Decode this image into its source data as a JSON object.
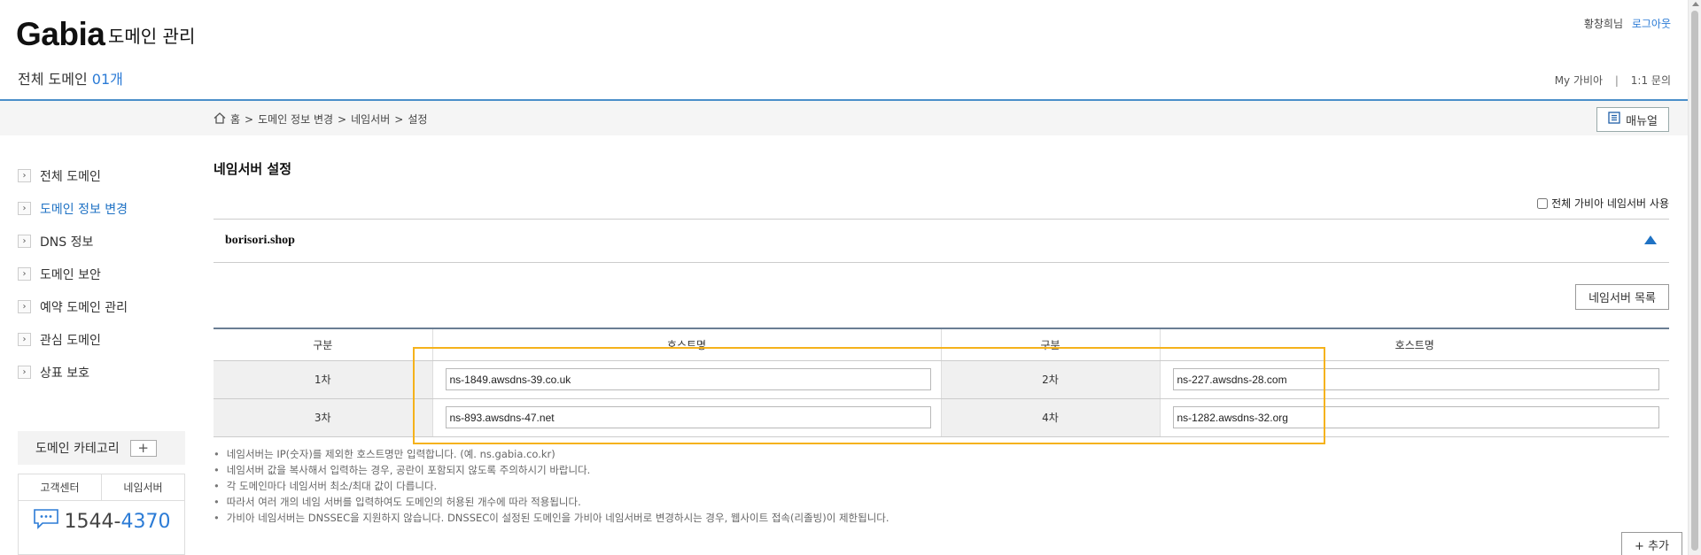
{
  "header": {
    "logo": "Gabia",
    "subtitle": "도메인 관리",
    "total_label": "전체 도메인",
    "total_count": "01개",
    "user_name": "황창희님",
    "logout": "로그아웃",
    "util_links": [
      "My 가비아",
      "1:1 문의"
    ]
  },
  "breadcrumb": {
    "home": "홈",
    "items": [
      "도메인 정보 변경",
      "네임서버",
      "설정"
    ],
    "separator": ">"
  },
  "manual_button": "매뉴얼",
  "sidebar": {
    "items": [
      {
        "label": "전체 도메인",
        "active": false
      },
      {
        "label": "도메인 정보 변경",
        "active": true
      },
      {
        "label": "DNS 정보",
        "active": false
      },
      {
        "label": "도메인 보안",
        "active": false
      },
      {
        "label": "예약 도메인 관리",
        "active": false
      },
      {
        "label": "관심 도메인",
        "active": false
      },
      {
        "label": "상표 보호",
        "active": false
      }
    ],
    "category_label": "도메인 카테고리",
    "category_add": "+",
    "support_tabs": [
      "고객센터",
      "네임서버"
    ],
    "phone_prefix": "1544-",
    "phone_suffix": "4370"
  },
  "main": {
    "title": "네임서버 설정",
    "all_gabia_ns_label": "전체 가비아 네임서버 사용",
    "domain": "borisori.shop",
    "ns_list_button": "네임서버 목록",
    "table_headers": [
      "구분",
      "호스트명",
      "구분",
      "호스트명"
    ],
    "rows": [
      {
        "label_a": "1차",
        "host_a": "ns-1849.awsdns-39.co.uk",
        "label_b": "2차",
        "host_b": "ns-227.awsdns-28.com"
      },
      {
        "label_a": "3차",
        "host_a": "ns-893.awsdns-47.net",
        "label_b": "4차",
        "host_b": "ns-1282.awsdns-32.org"
      }
    ],
    "notes": [
      "네임서버는 IP(숫자)를 제외한 호스트명만 입력합니다. (예. ns.gabia.co.kr)",
      "네임서버 값을 복사해서 입력하는 경우, 공란이 포함되지 않도록 주의하시기 바랍니다.",
      "각 도메인마다 네임서버 최소/최대 값이 다릅니다.",
      "따라서 여러 개의 네임 서버를 입력하여도 도메인의 허용된 개수에 따라 적용됩니다.",
      "가비아 네임서버는 DNSSEC을 지원하지 않습니다. DNSSEC이 설정된 도메인을 가비아 네임서버로 변경하시는 경우, 웹사이트 접속(리졸빙)이 제한됩니다."
    ],
    "add_button": "+ 추가"
  },
  "colors": {
    "accent_blue": "#2b7bd6",
    "highlight": "#f5b21b",
    "header_rule": "#4a8fc9"
  }
}
